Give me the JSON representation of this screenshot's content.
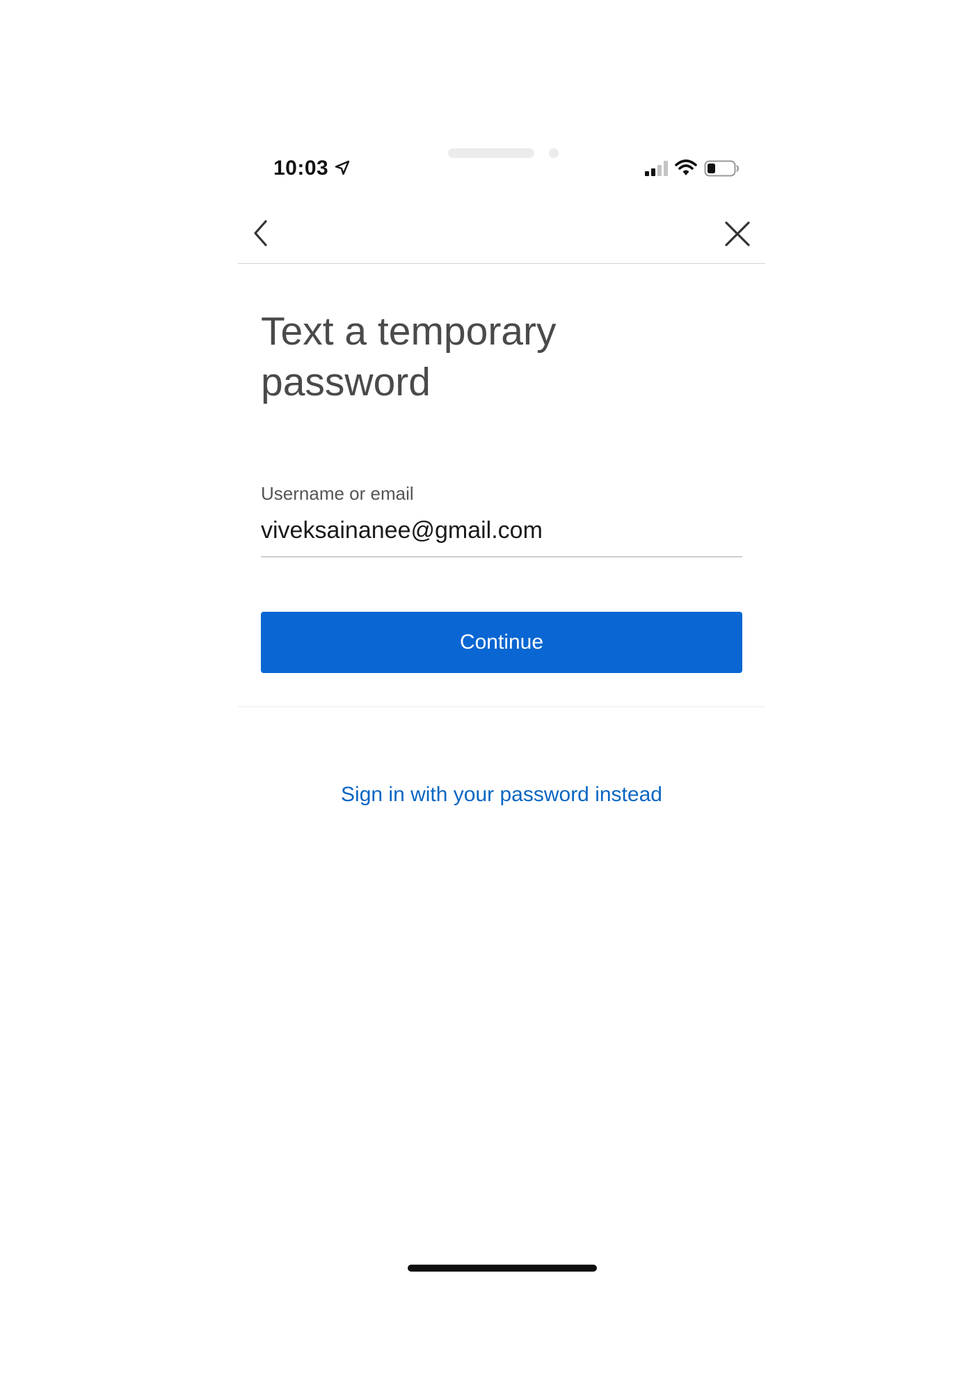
{
  "status_bar": {
    "time": "10:03",
    "icons": [
      "location-arrow-icon",
      "cellular-signal-icon",
      "wifi-icon",
      "battery-icon"
    ]
  },
  "nav": {
    "back_icon": "chevron-left-icon",
    "close_icon": "close-icon"
  },
  "page": {
    "title": "Text a temporary password"
  },
  "form": {
    "username_label": "Username or email",
    "username_value": "viveksainanee@gmail.com",
    "continue_label": "Continue"
  },
  "links": {
    "sign_in_with_password": "Sign in with your password instead"
  },
  "colors": {
    "primary_button": "#0a66d2",
    "link": "#0a66c2",
    "title_text": "#4a4a4a"
  }
}
